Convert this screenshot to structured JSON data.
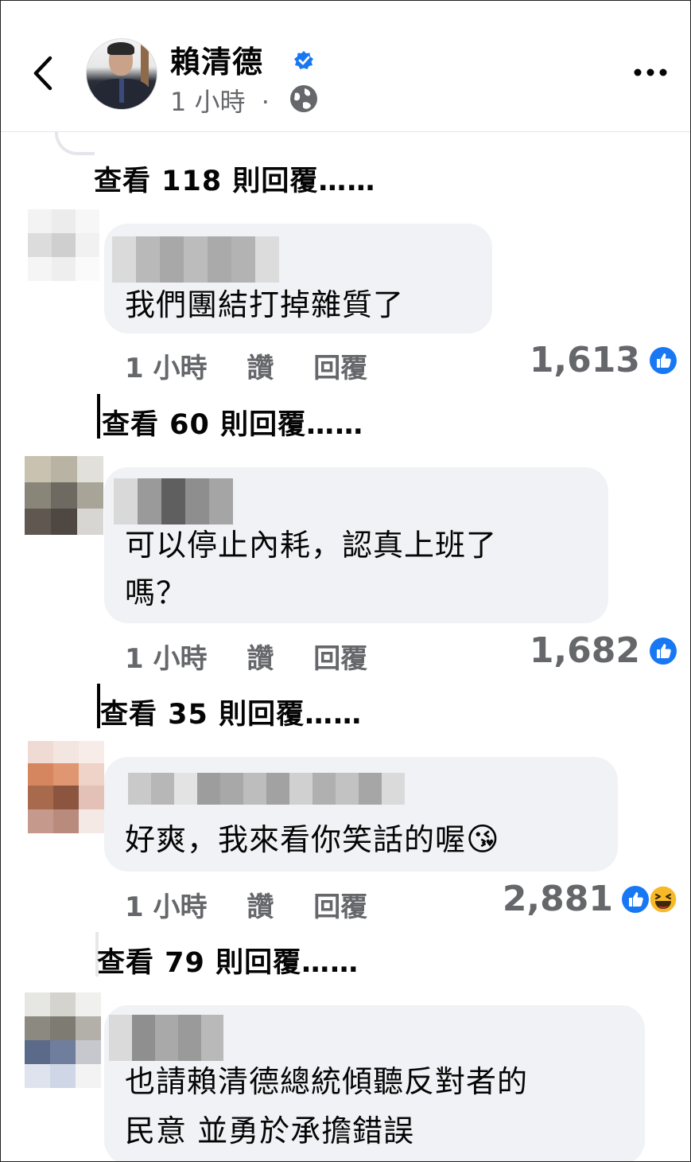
{
  "header": {
    "page_name": "賴清德",
    "time": "1 小時",
    "separator": "·"
  },
  "top_view_replies": "查看 118 則回覆……",
  "comments": [
    {
      "text_lines": [
        "我們團結打掉雜質了"
      ],
      "time": "1 小時",
      "like_label": "讚",
      "reply_label": "回覆",
      "reaction_count": "1,613",
      "reactions": [
        "like-icon"
      ],
      "view_replies": "查看 60 則回覆……"
    },
    {
      "text_lines": [
        "可以停止內耗，認真上班了",
        "嗎？"
      ],
      "time": "1 小時",
      "like_label": "讚",
      "reply_label": "回覆",
      "reaction_count": "1,682",
      "reactions": [
        "like-icon"
      ],
      "view_replies": "查看 35 則回覆……"
    },
    {
      "text_lines": [
        "好爽，我來看你笑話的喔"
      ],
      "emoji": "😘",
      "time": "1 小時",
      "like_label": "讚",
      "reply_label": "回覆",
      "reaction_count": "2,881",
      "reactions": [
        "like-icon",
        "haha-icon"
      ],
      "view_replies": "查看 79 則回覆……"
    },
    {
      "text_lines": [
        "也請賴清德總統傾聽反對者的",
        "民意 並勇於承擔錯誤"
      ]
    }
  ],
  "colors": {
    "like_blue": "#1877f2",
    "haha_yellow": "#f7b928",
    "bubble_gray": "#f0f2f5",
    "meta_gray": "#65676b"
  }
}
